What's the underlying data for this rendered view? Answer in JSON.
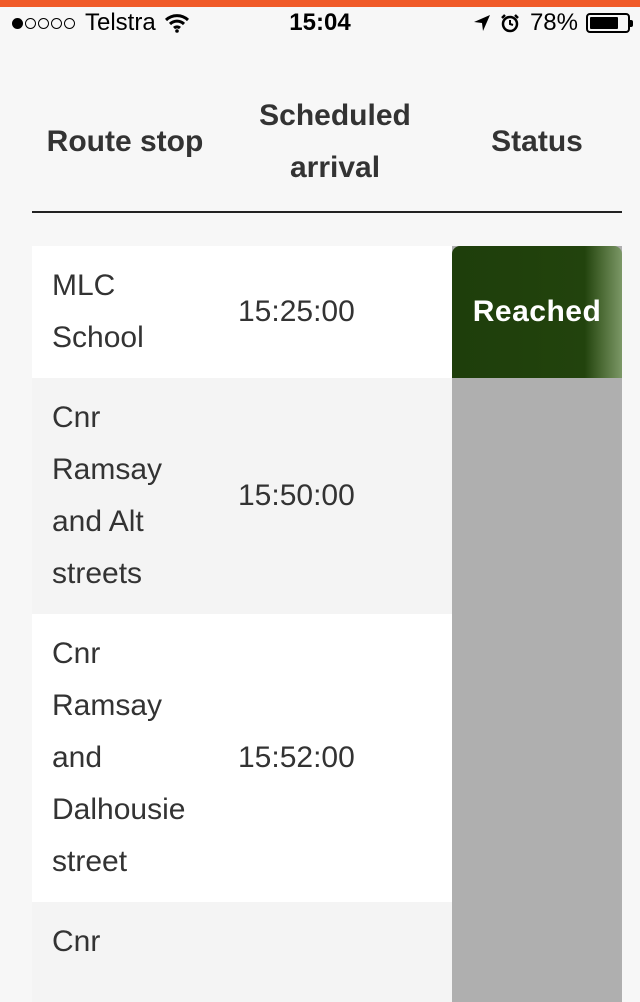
{
  "status_bar": {
    "carrier": "Telstra",
    "time": "15:04",
    "battery_percent": "78%",
    "battery_level": 0.78,
    "signal_bars_filled": 1,
    "signal_bars_total": 5
  },
  "colors": {
    "accent": "#f05a28",
    "reached": "#22430d",
    "pending": "#afafaf"
  },
  "table": {
    "headers": {
      "route_stop": "Route stop",
      "scheduled_arrival": "Scheduled arrival",
      "status": "Status"
    },
    "rows": [
      {
        "stop": "MLC School",
        "time": "15:25:00",
        "status": "Reached"
      },
      {
        "stop": "Cnr Ramsay and Alt streets",
        "time": "15:50:00",
        "status": ""
      },
      {
        "stop": "Cnr Ramsay and Dalhousie street",
        "time": "15:52:00",
        "status": ""
      },
      {
        "stop": "Cnr",
        "time": "",
        "status": ""
      }
    ]
  }
}
